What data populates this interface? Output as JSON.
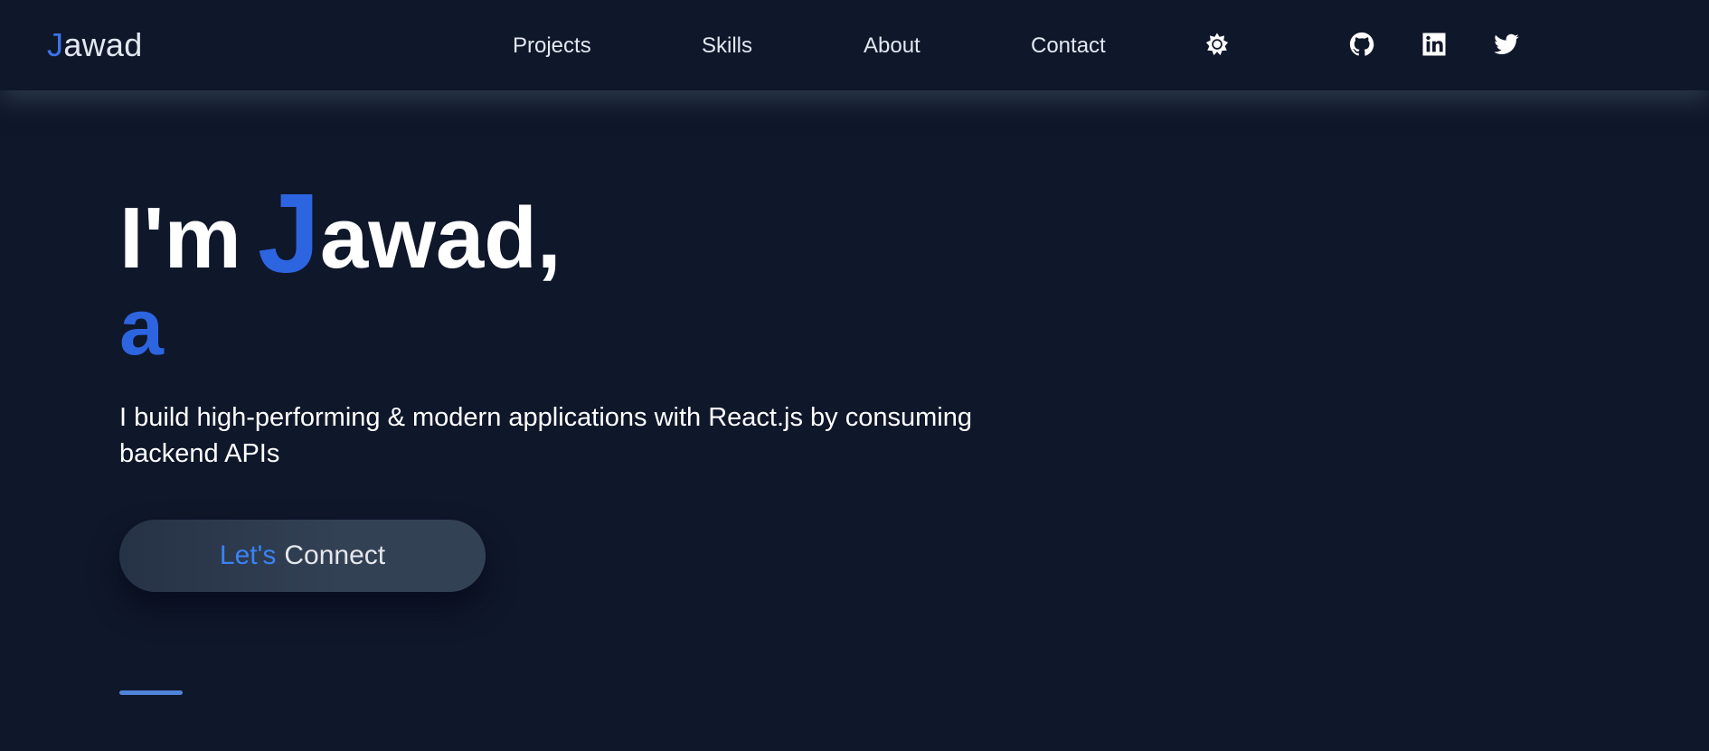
{
  "header": {
    "logo": {
      "accent": "J",
      "rest": "awad"
    },
    "nav": [
      {
        "label": "Projects"
      },
      {
        "label": "Skills"
      },
      {
        "label": "About"
      },
      {
        "label": "Contact"
      }
    ],
    "icons": [
      "sun-icon",
      "github-icon",
      "linkedin-icon",
      "twitter-icon"
    ]
  },
  "hero": {
    "greeting": "I'm",
    "name_accent": "J",
    "name_rest": "awad,",
    "role_text": "a",
    "subtitle": "I build high-performing & modern applications with React.js by consuming backend APIs",
    "cta": {
      "part1": "Let's",
      "part2": "Connect"
    }
  },
  "colors": {
    "background": "#0f172a",
    "accent": "#2d64e0",
    "button": "#334155"
  }
}
